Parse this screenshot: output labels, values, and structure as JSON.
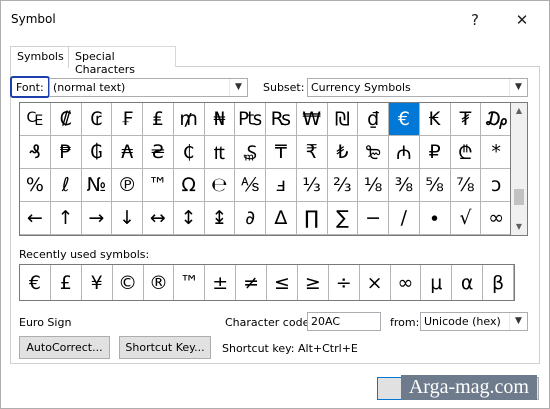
{
  "window": {
    "title": "Symbol",
    "help_glyph": "?",
    "close_glyph": "✕"
  },
  "tabs": [
    {
      "label": "Symbols",
      "active": true
    },
    {
      "label": "Special Characters",
      "active": false
    }
  ],
  "font": {
    "label": "Font:",
    "value": "(normal text)"
  },
  "subset": {
    "label": "Subset:",
    "value": "Currency Symbols"
  },
  "symbols": [
    [
      "₠",
      "₡",
      "₢",
      "₣",
      "₤",
      "₥",
      "₦",
      "₧",
      "₨",
      "₩",
      "₪",
      "₫",
      "€",
      "₭",
      "₮",
      "₯"
    ],
    [
      "₰",
      "₱",
      "₲",
      "₳",
      "₴",
      "₵",
      "₶",
      "₷",
      "₸",
      "₹",
      "₺",
      "₻",
      "₼",
      "₽",
      "₾",
      "*"
    ],
    [
      "%",
      "ℓ",
      "№",
      "℗",
      "™",
      "Ω",
      "℮",
      "⅍",
      "ⅎ",
      "⅓",
      "⅔",
      "⅛",
      "⅜",
      "⅝",
      "⅞",
      "ↄ"
    ],
    [
      "←",
      "↑",
      "→",
      "↓",
      "↔",
      "↕",
      "↨",
      "∂",
      "∆",
      "∏",
      "∑",
      "−",
      "∕",
      "∙",
      "√",
      "∞"
    ]
  ],
  "selected_symbol": "€",
  "recent": {
    "label": "Recently used symbols:",
    "items": [
      "€",
      "£",
      "¥",
      "©",
      "®",
      "™",
      "±",
      "≠",
      "≤",
      "≥",
      "÷",
      "×",
      "∞",
      "μ",
      "α",
      "β"
    ]
  },
  "char_name": "Euro Sign",
  "char_code": {
    "label": "Character code:",
    "value": "20AC"
  },
  "from": {
    "label": "from:",
    "value": "Unicode (hex)"
  },
  "buttons": {
    "autocorrect": "AutoCorrect...",
    "shortcut_key": "Shortcut Key..."
  },
  "shortcut_text": "Shortcut key: Alt+Ctrl+E",
  "watermark": "Arga-mag.com",
  "colors": {
    "selection": "#0078d7",
    "focus_box": "#1c3faa"
  }
}
